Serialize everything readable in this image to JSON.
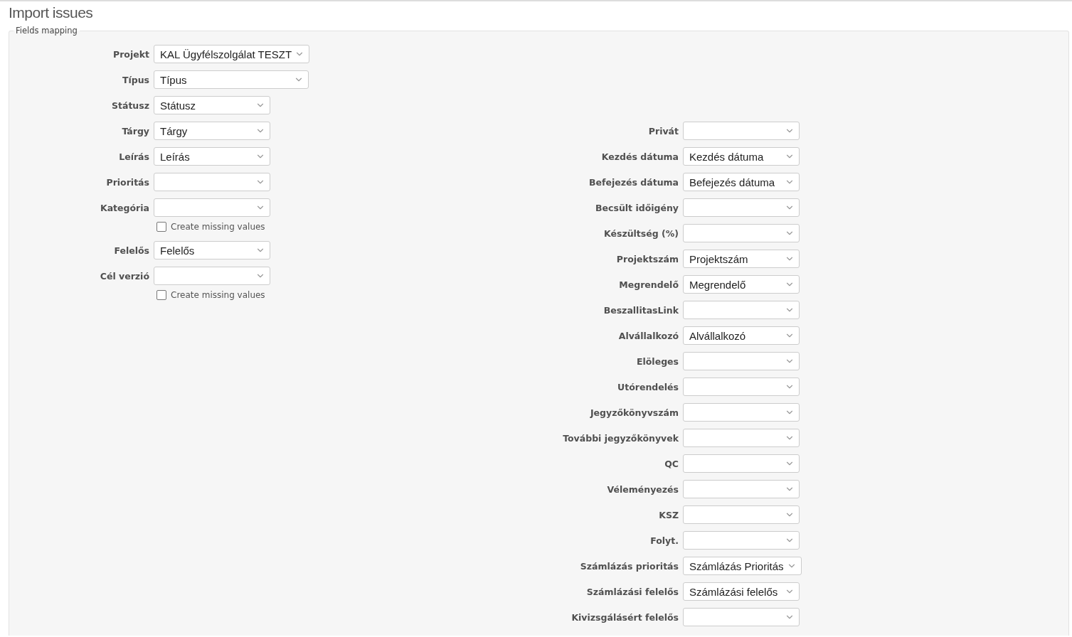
{
  "title": "Import issues",
  "fieldset": {
    "legend": "Fields mapping",
    "left_fields": [
      {
        "kind": "select",
        "label": "Projekt",
        "value": "KAL Ügyfélszolgálat TESZT"
      },
      {
        "kind": "select",
        "label": "Típus",
        "value": "Típus",
        "wide": true
      },
      {
        "kind": "select",
        "label": "Státusz",
        "value": "Státusz"
      },
      {
        "kind": "select",
        "label": "Tárgy",
        "value": "Tárgy"
      },
      {
        "kind": "select",
        "label": "Leírás",
        "value": "Leírás"
      },
      {
        "kind": "select",
        "label": "Prioritás"
      },
      {
        "kind": "select",
        "label": "Kategória"
      },
      {
        "kind": "checkbox",
        "label": "Create missing values",
        "checked": false
      },
      {
        "kind": "select",
        "label": "Felelős",
        "value": "Felelős"
      },
      {
        "kind": "select",
        "label": "Cél verzió"
      },
      {
        "kind": "checkbox",
        "label": "Create missing values",
        "checked": false
      }
    ],
    "right_fields": [
      {
        "kind": "select",
        "label": "Privát"
      },
      {
        "kind": "select",
        "label": "Kezdés dátuma",
        "value": "Kezdés dátuma"
      },
      {
        "kind": "select",
        "label": "Befejezés dátuma",
        "value": "Befejezés dátuma"
      },
      {
        "kind": "select",
        "label": "Becsült időigény"
      },
      {
        "kind": "select",
        "label": "Készültség (%)"
      },
      {
        "kind": "select",
        "label": "Projektszám",
        "value": "Projektszám"
      },
      {
        "kind": "select",
        "label": "Megrendelő",
        "value": "Megrendelő"
      },
      {
        "kind": "select",
        "label": "BeszallitasLink"
      },
      {
        "kind": "select",
        "label": "Alvállalkozó",
        "value": "Alvállalkozó"
      },
      {
        "kind": "select",
        "label": "Elöleges"
      },
      {
        "kind": "select",
        "label": "Utórendelés"
      },
      {
        "kind": "select",
        "label": "Jegyzőkönyvszám"
      },
      {
        "kind": "select",
        "label": "További jegyzőkönyvek"
      },
      {
        "kind": "select",
        "label": "QC"
      },
      {
        "kind": "select",
        "label": "Véleményezés"
      },
      {
        "kind": "select",
        "label": "KSZ"
      },
      {
        "kind": "select",
        "label": "Folyt."
      },
      {
        "kind": "select",
        "label": "Számlázás prioritás",
        "value": "Számlázás Prioritás"
      },
      {
        "kind": "select",
        "label": "Számlázási felelős",
        "value": "Számlázási felelős"
      },
      {
        "kind": "select",
        "label": "Kivizsgálásért felelős"
      }
    ]
  }
}
